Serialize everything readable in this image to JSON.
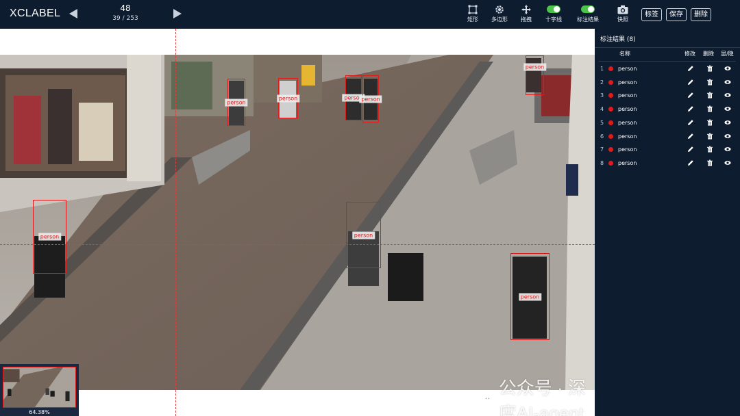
{
  "app": {
    "title": "XCLABEL"
  },
  "nav": {
    "current_index": "48",
    "position": "39 / 253",
    "prev_icon": "triangle-left-icon",
    "next_icon": "triangle-right-icon"
  },
  "tools": {
    "rect": "矩形",
    "polygon": "多边形",
    "drag": "拖拽",
    "crosshair": "十字线",
    "show_annotations": "标注结果",
    "snapshot": "快照",
    "crosshair_enabled": true,
    "show_annotations_enabled": true
  },
  "buttons": {
    "label": "标签",
    "save": "保存",
    "delete": "删除"
  },
  "canvas": {
    "zoom": "64.38%",
    "annotations": [
      {
        "label": "person"
      },
      {
        "label": "person"
      },
      {
        "label": "person"
      },
      {
        "label": "person"
      },
      {
        "label": "person"
      },
      {
        "label": "person"
      },
      {
        "label": "person"
      },
      {
        "label": "person"
      }
    ]
  },
  "watermark": {
    "text": "公众号 · 深度AI-agent"
  },
  "panel": {
    "title": "标注结果 (8)",
    "columns": {
      "name": "名称",
      "edit": "修改",
      "delete": "删除",
      "toggle": "显/隐"
    },
    "items": [
      {
        "index": "1",
        "name": "person",
        "color": "#e01b1b"
      },
      {
        "index": "2",
        "name": "person",
        "color": "#e01b1b"
      },
      {
        "index": "3",
        "name": "person",
        "color": "#e01b1b"
      },
      {
        "index": "4",
        "name": "person",
        "color": "#e01b1b"
      },
      {
        "index": "5",
        "name": "person",
        "color": "#e01b1b"
      },
      {
        "index": "6",
        "name": "person",
        "color": "#e01b1b"
      },
      {
        "index": "7",
        "name": "person",
        "color": "#e01b1b"
      },
      {
        "index": "8",
        "name": "person",
        "color": "#e01b1b"
      }
    ]
  },
  "colors": {
    "topbar": "#0e1c30",
    "box": "#e01b1b",
    "toggle_on": "#4cc34a"
  }
}
